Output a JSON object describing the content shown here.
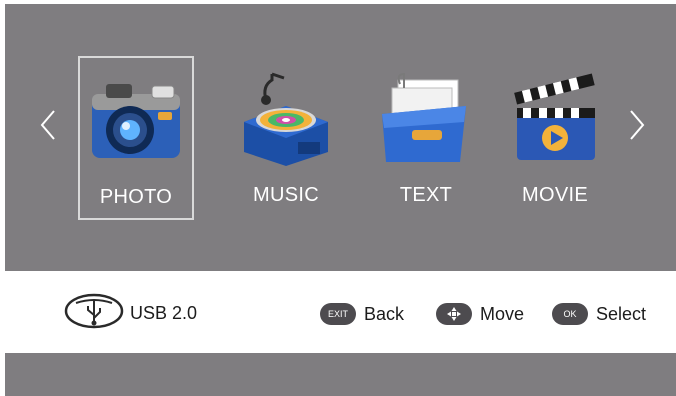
{
  "colors": {
    "panel": "#7f7d80",
    "selection_border": "#d9d9d9",
    "text_light": "#ffffff",
    "text_dark": "#1c1c1c",
    "pill": "#4d4b4f"
  },
  "nav": {
    "prev_icon": "chevron-left-icon",
    "next_icon": "chevron-right-icon"
  },
  "menu": {
    "selected_index": 0,
    "items": [
      {
        "label": "PHOTO",
        "icon": "camera-icon"
      },
      {
        "label": "MUSIC",
        "icon": "music-player-icon"
      },
      {
        "label": "TEXT",
        "icon": "document-folder-icon"
      },
      {
        "label": "MOVIE",
        "icon": "clapperboard-icon"
      }
    ]
  },
  "status": {
    "source_icon": "usb-icon",
    "source_label": "USB 2.0"
  },
  "hints": [
    {
      "key": "EXIT",
      "label": "Back"
    },
    {
      "key": "+",
      "label": "Move"
    },
    {
      "key": "OK",
      "label": "Select"
    }
  ]
}
